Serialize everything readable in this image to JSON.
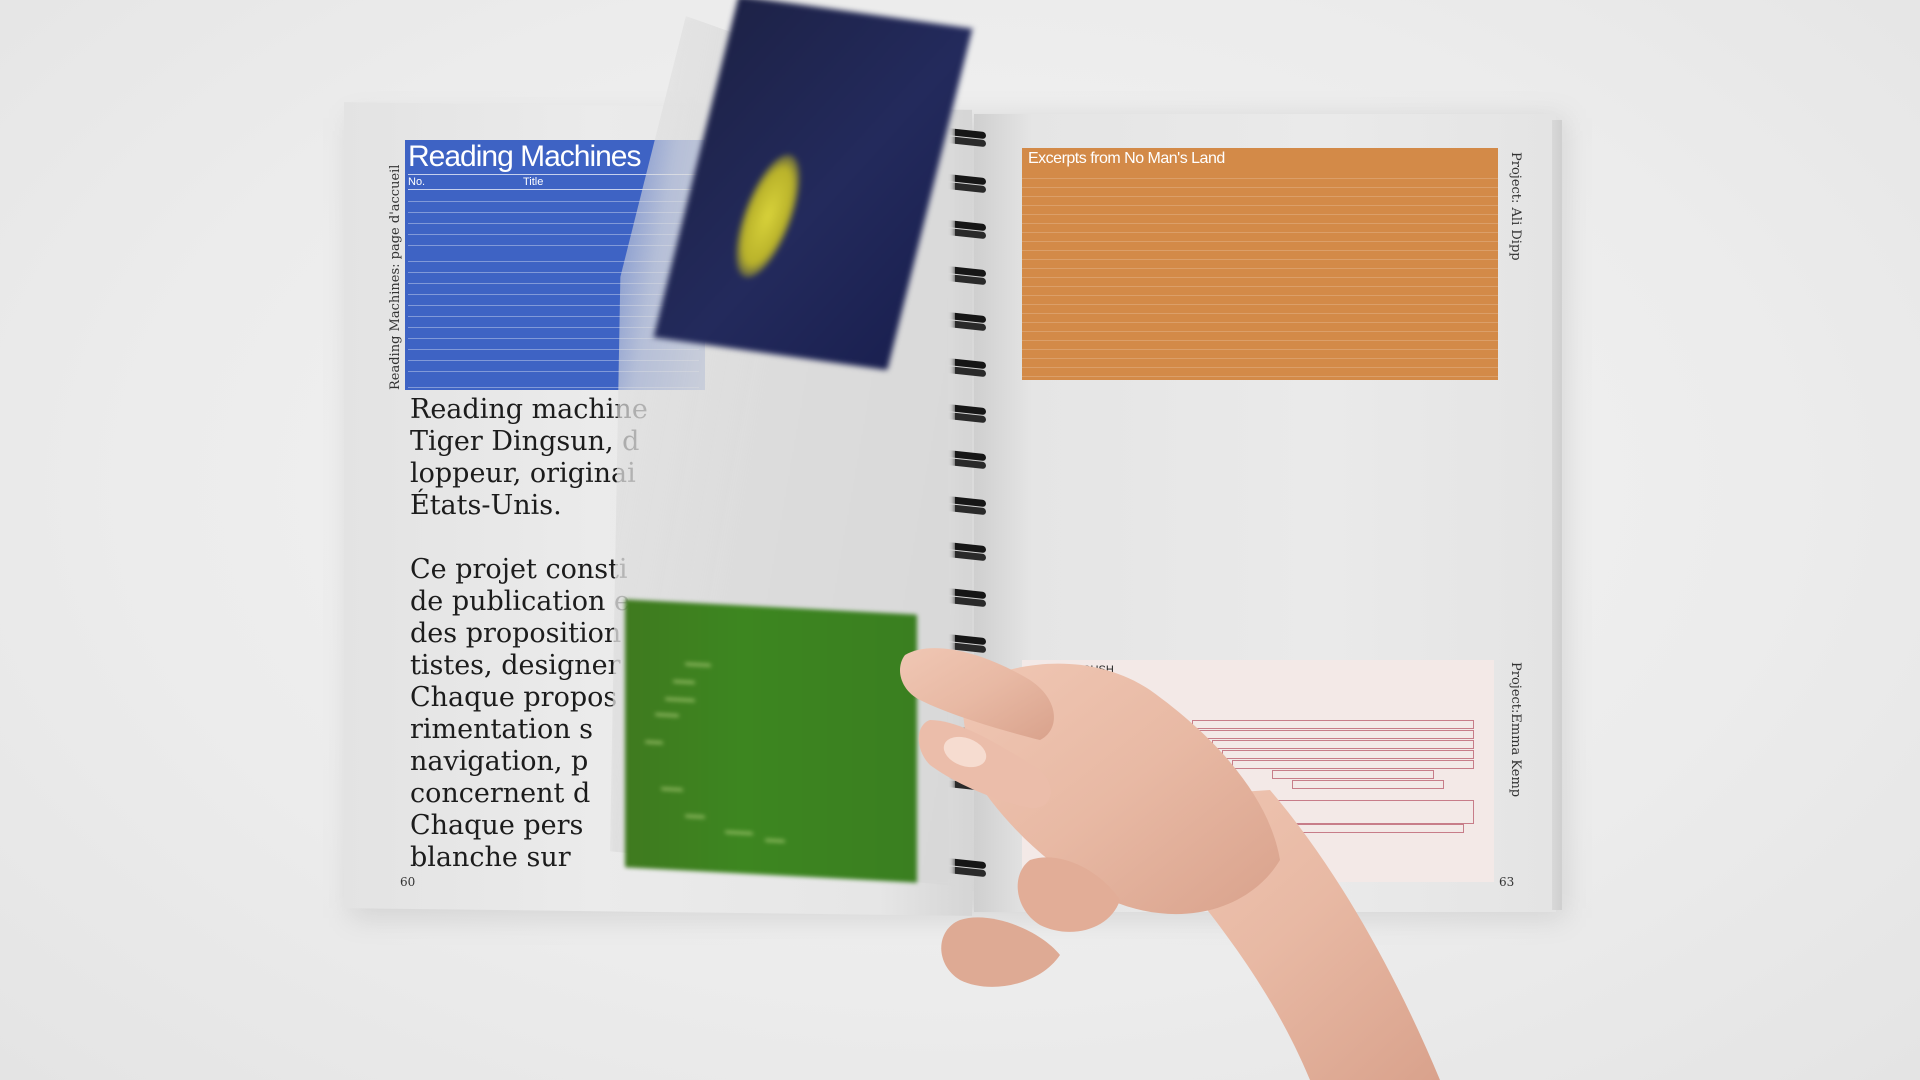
{
  "book": {
    "left_page": {
      "panel": {
        "title": "Reading Machines",
        "columns": [
          "No.",
          "Title"
        ]
      },
      "side_label": "Reading Machines: page d'accueil",
      "paragraph_1": "Reading machine\nTiger Dingsun, d\nloppeur, originai\nÉtats-Unis.",
      "paragraph_2": "Ce projet consti\nde publication e\ndes proposition\ntistes, designer\nChaque propos\nrimentation s\nnavigation, p\nconcernent d\nChaque pers\nblanche sur",
      "page_number": "60"
    },
    "right_page": {
      "orange_panel": {
        "title": "Excerpts from No Man's Land"
      },
      "side_label_top": "Project: Ali Dipp",
      "pink_panel": {
        "title": "GUSH"
      },
      "side_label_bottom": "Project:Emma Kemp",
      "page_number": "63"
    }
  },
  "colors": {
    "blue_panel": "#3e63c4",
    "orange_panel": "#d38a48",
    "green_page": "#3d8620",
    "spiral": "#161616"
  }
}
